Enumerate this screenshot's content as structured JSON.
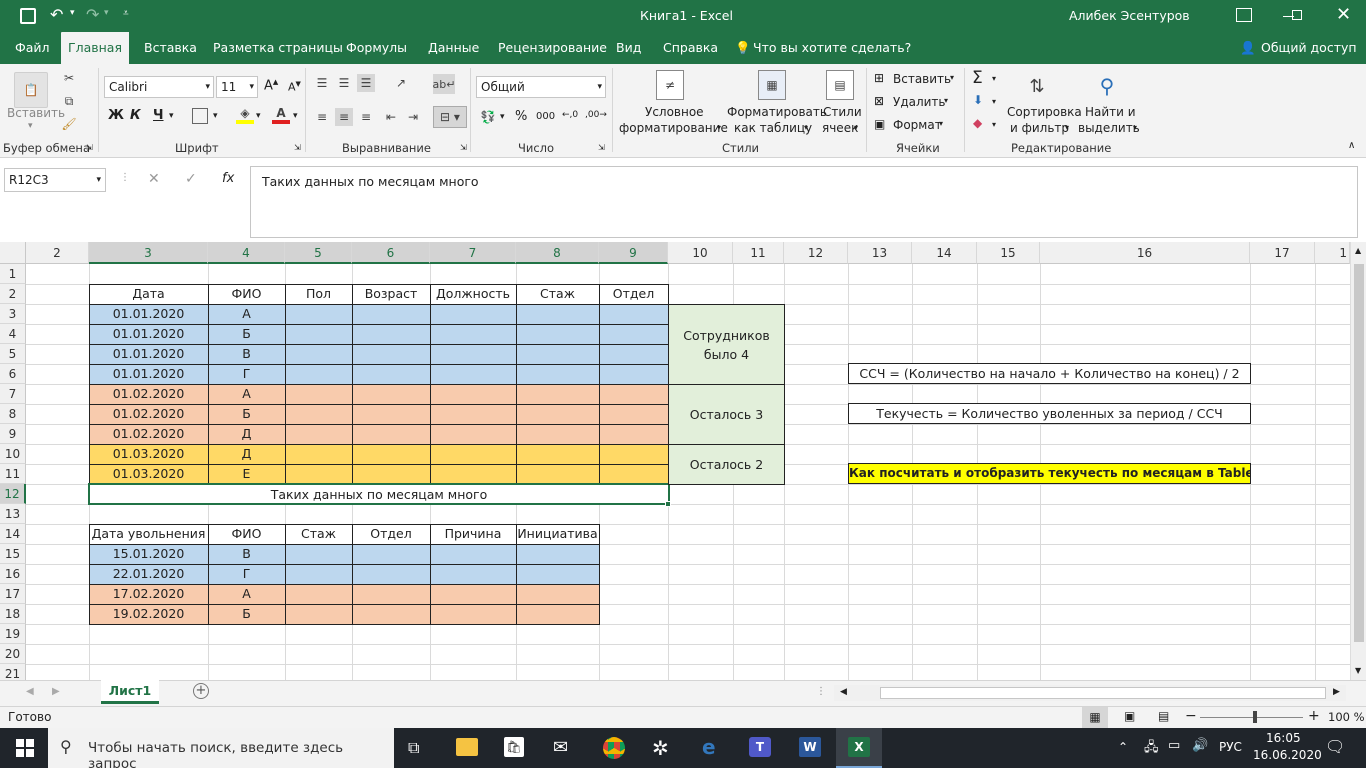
{
  "window": {
    "title": "Книга1  -  Excel",
    "user": "Алибек Эсентуров"
  },
  "tabs": {
    "file": "Файл",
    "home": "Главная",
    "insert": "Вставка",
    "layout": "Разметка страницы",
    "formulas": "Формулы",
    "data": "Данные",
    "review": "Рецензирование",
    "view": "Вид",
    "help": "Справка",
    "tellme": "Что вы хотите сделать?",
    "share": "Общий доступ"
  },
  "ribbon": {
    "paste": "Вставить",
    "clipboard": "Буфер обмена",
    "font_name": "Calibri",
    "font_size": "11",
    "bold": "Ж",
    "italic": "К",
    "underline": "Ч",
    "font_group": "Шрифт",
    "align_group": "Выравнивание",
    "number_format": "Общий",
    "number_group": "Число",
    "percent": "%",
    "thousands": "000",
    "cond_format_1": "Условное",
    "cond_format_2": "форматирование",
    "format_table_1": "Форматировать",
    "format_table_2": "как таблицу",
    "styles_1": "Стили",
    "styles_2": "ячеек",
    "styles_group": "Стили",
    "insert_cells": "Вставить",
    "delete_cells": "Удалить",
    "format_cells": "Формат",
    "cells_group": "Ячейки",
    "sort_1": "Сортировка",
    "sort_2": "и фильтр",
    "find_1": "Найти и",
    "find_2": "выделить",
    "editing_group": "Редактирование"
  },
  "formula_bar": {
    "name_box": "R12C3",
    "formula": "Таких данных по месяцам много"
  },
  "columns": [
    "2",
    "3",
    "4",
    "5",
    "6",
    "7",
    "8",
    "9",
    "10",
    "11",
    "12",
    "13",
    "14",
    "15",
    "16",
    "17",
    "1"
  ],
  "rows": [
    "1",
    "2",
    "3",
    "4",
    "5",
    "6",
    "7",
    "8",
    "9",
    "10",
    "11",
    "12",
    "13",
    "14",
    "15",
    "16",
    "17",
    "18",
    "19",
    "20",
    "21"
  ],
  "table1": {
    "headers": [
      "Дата",
      "ФИО",
      "Пол",
      "Возраст",
      "Должность",
      "Стаж",
      "Отдел"
    ],
    "rows": [
      {
        "date": "01.01.2020",
        "fio": "А"
      },
      {
        "date": "01.01.2020",
        "fio": "Б"
      },
      {
        "date": "01.01.2020",
        "fio": "В"
      },
      {
        "date": "01.01.2020",
        "fio": "Г"
      },
      {
        "date": "01.02.2020",
        "fio": "А"
      },
      {
        "date": "01.02.2020",
        "fio": "Б"
      },
      {
        "date": "01.02.2020",
        "fio": "Д"
      },
      {
        "date": "01.03.2020",
        "fio": "Д"
      },
      {
        "date": "01.03.2020",
        "fio": "Е"
      }
    ],
    "merged_note": "Таких данных по месяцам много"
  },
  "summary": {
    "was_1": "Сотрудников",
    "was_2": "было 4",
    "left3": "Осталось 3",
    "left2": "Осталось 2"
  },
  "notes": {
    "formula1": "ССЧ = (Количество на начало + Количество на конец) / 2",
    "formula2": "Текучесть = Количество уволенных за период / ССЧ",
    "question": "Как посчитать и отобразить текучесть по месяцам в Tableau?"
  },
  "table2": {
    "headers": [
      "Дата увольнения",
      "ФИО",
      "Стаж",
      "Отдел",
      "Причина",
      "Инициатива"
    ],
    "rows": [
      {
        "date": "15.01.2020",
        "fio": "В"
      },
      {
        "date": "22.01.2020",
        "fio": "Г"
      },
      {
        "date": "17.02.2020",
        "fio": "А"
      },
      {
        "date": "19.02.2020",
        "fio": "Б"
      }
    ]
  },
  "sheet": {
    "tab": "Лист1"
  },
  "status": {
    "ready": "Готово",
    "zoom": "100 %"
  },
  "taskbar": {
    "search": "Чтобы начать поиск, введите здесь запрос",
    "lang": "РУС",
    "time": "16:05",
    "date": "16.06.2020"
  },
  "colors": {
    "excel_green": "#217346",
    "blue_fill": "#bdd7ee",
    "orange_fill": "#f8cbad",
    "yellow_fill": "#ffd966",
    "green_fill": "#e2efda",
    "question_fill": "#ffff00"
  }
}
